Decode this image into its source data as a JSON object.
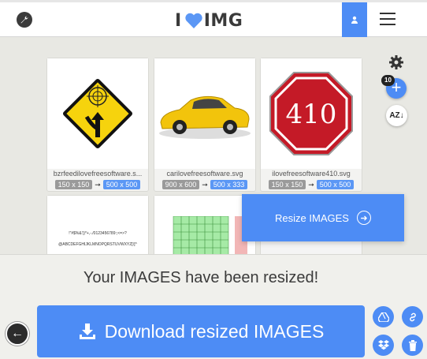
{
  "header": {
    "logo_i": "I",
    "logo_img": "IMG",
    "icons": {
      "settings": "wrench-icon",
      "user": "user-icon",
      "menu": "hamburger-menu-icon"
    }
  },
  "files": [
    {
      "name": "bzrfeedilovefreesoftware.s...",
      "old": "150 x 150",
      "new": "500 x 500"
    },
    {
      "name": "carilovefreesoftware.svg",
      "old": "900 x 600",
      "new": "500 x 333"
    },
    {
      "name": "ilovefreesoftware410.svg",
      "old": "150 x 150",
      "new": "500 x 500"
    }
  ],
  "thumbnails": {
    "sign_410": "410",
    "font_line1": "!\"#$%&'()*+,-./0123456789:;<=>?",
    "font_line2": "@ABCDEFGHIJKLMNOPQRSTUVWXYZ[\\]^"
  },
  "tools": {
    "file_count": "10",
    "sort_label": "AZ↓"
  },
  "resize_button": {
    "label": "Resize IMAGES"
  },
  "result": {
    "message": "Your IMAGES have been resized!",
    "download_label": "Download resized IMAGES"
  },
  "colors": {
    "accent": "#4d8cf5",
    "background": "#e8e8e3",
    "dark": "#2c2c2c"
  }
}
